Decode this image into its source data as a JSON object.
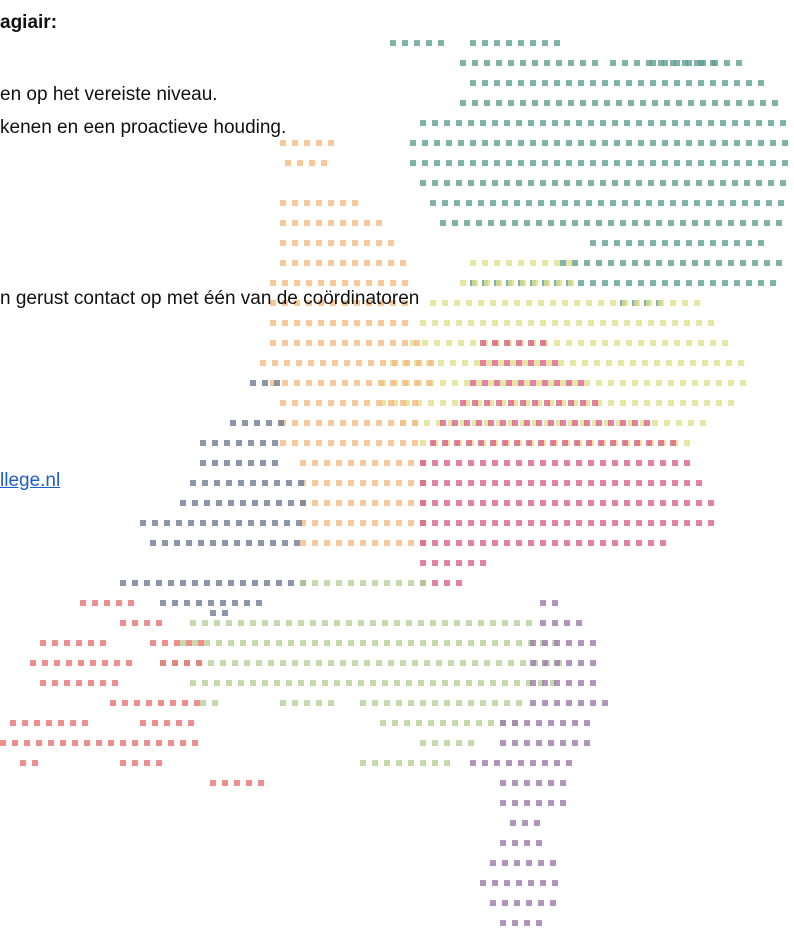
{
  "document": {
    "heading": "agiair:",
    "line1": "en op het vereiste niveau.",
    "line2": "kenen en een proactieve houding.",
    "line3": "n gerust contact op met één van de coördinatoren",
    "email_link": "llege.nl"
  },
  "map": {
    "image": "dotted-netherlands-map",
    "colors": {
      "teal": "#5f9e90",
      "yellow": "#dfe08a",
      "orange": "#f3b87f",
      "pink": "#d95f85",
      "slate": "#6e7a92",
      "green": "#b4cf95",
      "purple": "#9b78a8",
      "red": "#e66f6f"
    }
  }
}
